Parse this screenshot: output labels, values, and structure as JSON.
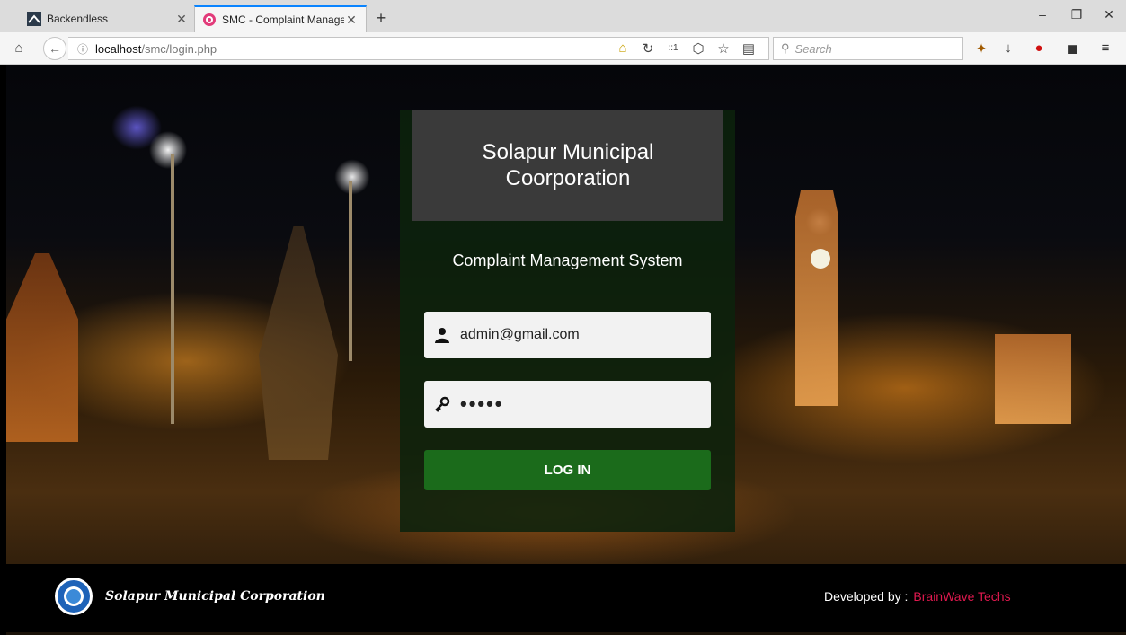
{
  "browser": {
    "tabs": [
      {
        "label": "Backendless",
        "active": false,
        "icon": "backendless-icon"
      },
      {
        "label": "SMC - Complaint Manage...",
        "active": true,
        "icon": "smc-favicon-icon"
      }
    ],
    "url_host": "localhost",
    "url_path": "/smc/login.php",
    "search_placeholder": "Search",
    "zoom_badge": "::1",
    "accent_color": "#0a84ff"
  },
  "login": {
    "title": "Solapur Municipal Coorporation",
    "subtitle": "Complaint Management System",
    "email_value": "admin@gmail.com",
    "password_value": "•••••",
    "login_button": "LOG IN",
    "button_color": "#1b6b1b"
  },
  "footer": {
    "org_name": "Solapur Municipal Corporation",
    "developed_by": "Developed by :",
    "developer": "BrainWave Techs",
    "developer_color": "#e0194f"
  }
}
